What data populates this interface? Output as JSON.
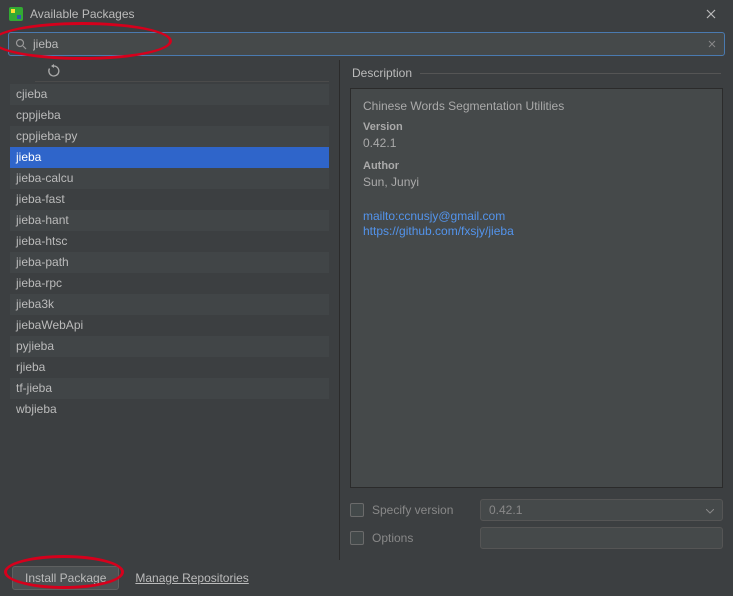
{
  "window": {
    "title": "Available Packages"
  },
  "search": {
    "value": "jieba"
  },
  "packages": [
    {
      "name": "cjieba",
      "selected": false
    },
    {
      "name": "cppjieba",
      "selected": false
    },
    {
      "name": "cppjieba-py",
      "selected": false
    },
    {
      "name": "jieba",
      "selected": true
    },
    {
      "name": "jieba-calcu",
      "selected": false
    },
    {
      "name": "jieba-fast",
      "selected": false
    },
    {
      "name": "jieba-hant",
      "selected": false
    },
    {
      "name": "jieba-htsc",
      "selected": false
    },
    {
      "name": "jieba-path",
      "selected": false
    },
    {
      "name": "jieba-rpc",
      "selected": false
    },
    {
      "name": "jieba3k",
      "selected": false
    },
    {
      "name": "jiebaWebApi",
      "selected": false
    },
    {
      "name": "pyjieba",
      "selected": false
    },
    {
      "name": "rjieba",
      "selected": false
    },
    {
      "name": "tf-jieba",
      "selected": false
    },
    {
      "name": "wbjieba",
      "selected": false
    }
  ],
  "description": {
    "section_label": "Description",
    "summary": "Chinese Words Segmentation Utilities",
    "version_label": "Version",
    "version": "0.42.1",
    "author_label": "Author",
    "author": "Sun, Junyi",
    "links": [
      "mailto:ccnusjy@gmail.com",
      "https://github.com/fxsjy/jieba"
    ]
  },
  "options": {
    "specify_version_label": "Specify version",
    "specify_version_value": "0.42.1",
    "options_label": "Options",
    "options_value": ""
  },
  "footer": {
    "install_label": "Install Package",
    "manage_label": "Manage Repositories"
  }
}
